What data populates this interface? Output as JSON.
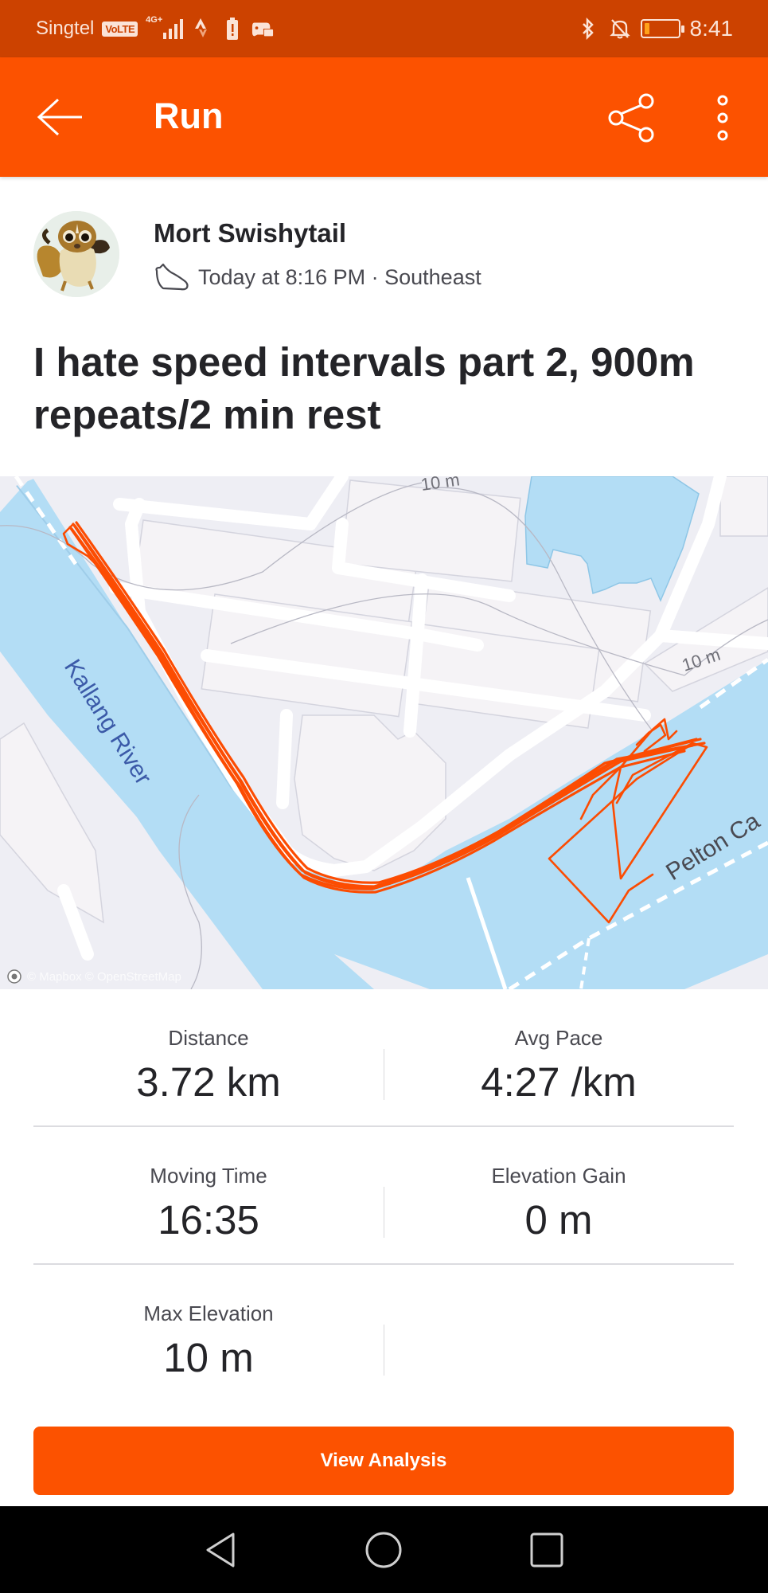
{
  "status_bar": {
    "carrier": "Singtel",
    "volte_badge": "VoLTE",
    "network_type": "4G+",
    "icons_left": [
      "volte-icon",
      "signal-icon",
      "strava-icon",
      "battery-alert-icon",
      "game-assistant-icon"
    ],
    "icons_right": [
      "bluetooth-icon",
      "bell-off-icon",
      "battery-icon"
    ],
    "battery_level_percent": 15,
    "battery_fill_color": "#ffa21a",
    "time": "8:41"
  },
  "app_bar": {
    "title": "Run",
    "back_icon": "arrow-left-icon",
    "share_icon": "share-icon",
    "more_icon": "more-vertical-icon",
    "color": "#fc5200"
  },
  "athlete": {
    "name": "Mort Swishytail",
    "activity_icon": "shoe-icon",
    "meta": "Today at 8:16 PM · Southeast"
  },
  "activity": {
    "title": "I hate speed intervals part 2, 900m repeats/2 min rest"
  },
  "map": {
    "labels": {
      "river": "Kallang River",
      "street_partial": "Pelton Ca",
      "contour_1": "10 m",
      "contour_2": "10 m"
    },
    "attribution": "© Mapbox © OpenStreetMap",
    "route_color": "#fc4c02",
    "water_color": "#b3ddf5",
    "land_color": "#eeeef4"
  },
  "stats": [
    {
      "label": "Distance",
      "value": "3.72 km"
    },
    {
      "label": "Avg Pace",
      "value": "4:27 /km"
    },
    {
      "label": "Moving Time",
      "value": "16:35"
    },
    {
      "label": "Elevation Gain",
      "value": "0 m"
    },
    {
      "label": "Max Elevation",
      "value": "10 m"
    }
  ],
  "actions": {
    "view_analysis": "View Analysis"
  },
  "nav_bar": {
    "back": "nav-back-icon",
    "home": "nav-home-icon",
    "recents": "nav-recents-icon"
  }
}
